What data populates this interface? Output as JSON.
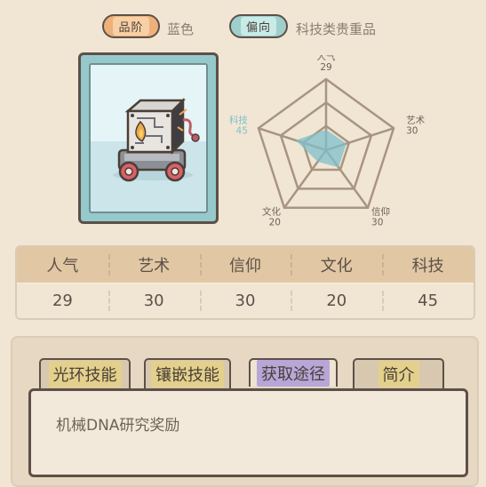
{
  "header": {
    "quality_label": "品阶",
    "quality_value": "蓝色",
    "orientation_label": "偏向",
    "orientation_value": "科技类贵重品"
  },
  "item": {
    "icon": "mechanical-box-robot-icon",
    "frame_color": "#95c9cc"
  },
  "radar": {
    "axes": [
      {
        "name": "人气",
        "value": 29
      },
      {
        "name": "艺术",
        "value": 30
      },
      {
        "name": "信仰",
        "value": 30
      },
      {
        "name": "文化",
        "value": 20
      },
      {
        "name": "科技",
        "value": 45
      }
    ],
    "highlight_color": "#7fbfcb"
  },
  "stats": {
    "headers": [
      "人气",
      "艺术",
      "信仰",
      "文化",
      "科技"
    ],
    "values": [
      "29",
      "30",
      "30",
      "20",
      "45"
    ]
  },
  "tabs": [
    {
      "label": "光环技能",
      "active": false
    },
    {
      "label": "镶嵌技能",
      "active": false
    },
    {
      "label": "获取途径",
      "active": true
    },
    {
      "label": "简介",
      "active": false
    }
  ],
  "content": {
    "text": "机械DNA研究奖励"
  }
}
